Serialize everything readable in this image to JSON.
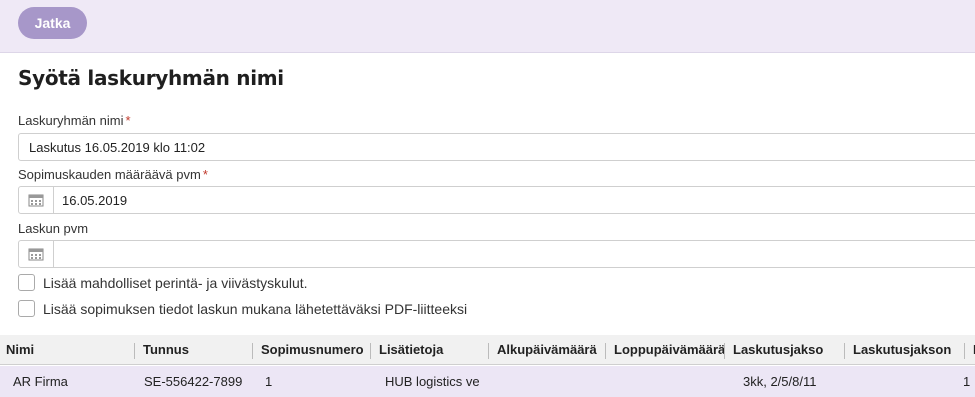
{
  "toolbar": {
    "continue_label": "Jatka"
  },
  "form": {
    "title": "Syötä laskuryhmän nimi",
    "group_name": {
      "label": "Laskuryhmän nimi",
      "required": "*",
      "value": "Laskutus 16.05.2019 klo 11:02"
    },
    "contract_date": {
      "label": "Sopimuskauden määräävä pvm",
      "required": "*",
      "value": "16.05.2019"
    },
    "invoice_date": {
      "label": "Laskun pvm",
      "value": ""
    },
    "checkbox_fees": "Lisää mahdolliset perintä- ja viivästyskulut.",
    "checkbox_pdf": "Lisää sopimuksen tiedot laskun mukana lähetettäväksi PDF-liitteeksi"
  },
  "table": {
    "columns": [
      "Nimi",
      "Tunnus",
      "Sopimusnumero",
      "Lisätietoja",
      "Alkupäivämäärä",
      "Loppupäivämäärä",
      "Laskutusjakso",
      "Laskutusjakson",
      "L"
    ],
    "rows": [
      [
        "AR Firma",
        "SE-556422-7899",
        "1",
        "HUB logistics ve",
        "",
        "",
        "3kk, 2/5/8/11",
        "",
        "1"
      ]
    ]
  },
  "icons": {
    "calendar": "calendar-icon"
  },
  "colors": {
    "topbar": "#efe9f6",
    "button": "#a797c9",
    "selected_row": "#ece6f5"
  }
}
